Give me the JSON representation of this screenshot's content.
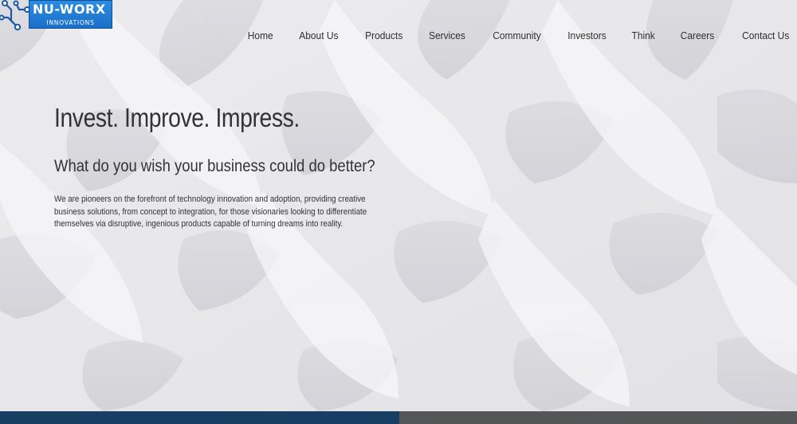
{
  "logo": {
    "title": "NU-WORX",
    "subtitle": "INNOVATIONS",
    "icon": "circuit-icon",
    "brand_color": "#1f78d1"
  },
  "nav": {
    "items": [
      {
        "label": "Home"
      },
      {
        "label": "About Us"
      },
      {
        "label": "Products"
      },
      {
        "label": "Services"
      },
      {
        "label": "Community"
      },
      {
        "label": "Investors"
      },
      {
        "label": "Think"
      },
      {
        "label": "Careers"
      },
      {
        "label": "Contact Us"
      }
    ]
  },
  "hero": {
    "title": "Invest. Improve. Impress.",
    "subtitle": "What do you wish your business could do better?",
    "body": "We are pioneers on the forefront of technology innovation and adoption, providing creative business solutions, from concept to integration, for those visionaries looking to differentiate themselves via disruptive, ingenious products capable of turning dreams into reality."
  },
  "colors": {
    "text": "#333333",
    "footer_left": "#173f63",
    "footer_right": "#545658",
    "background": "#e9e9ec"
  }
}
